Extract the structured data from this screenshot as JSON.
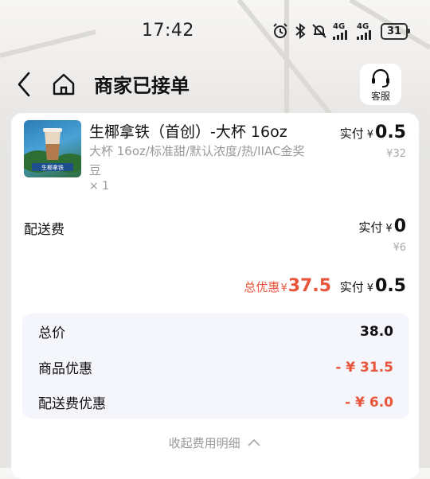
{
  "status_bar": {
    "time": "17:42",
    "network_1": "4G",
    "network_2": "4G",
    "battery": "31"
  },
  "header": {
    "title": "商家已接单",
    "service_label": "客服"
  },
  "product": {
    "thumbnail_text": "生椰拿铁",
    "name": "生椰拿铁（首创）-大杯 16oz",
    "spec": "大杯 16oz/标准甜/默认浓度/热/IIAC金奖豆",
    "qty": "× 1",
    "paid_label": "实付",
    "currency": "¥",
    "paid_amount": "0.5",
    "original_price": "¥32"
  },
  "delivery": {
    "label": "配送费",
    "paid_label": "实付",
    "currency": "¥",
    "paid_amount": "0",
    "original_price": "¥6"
  },
  "summary": {
    "discount_label": "总优惠",
    "currency": "¥",
    "discount_amount": "37.5",
    "paid_label": "实付",
    "paid_amount": "0.5"
  },
  "breakdown": [
    {
      "label": "总价",
      "value": "38.0"
    },
    {
      "label": "商品优惠",
      "value": "- ¥ 31.5"
    },
    {
      "label": "配送费优惠",
      "value": "- ¥ 6.0"
    }
  ],
  "collapse_label": "收起费用明细",
  "colors": {
    "accent_red": "#e8553a",
    "card_bg": "#ffffff",
    "breakdown_bg": "#f4f6fb"
  }
}
